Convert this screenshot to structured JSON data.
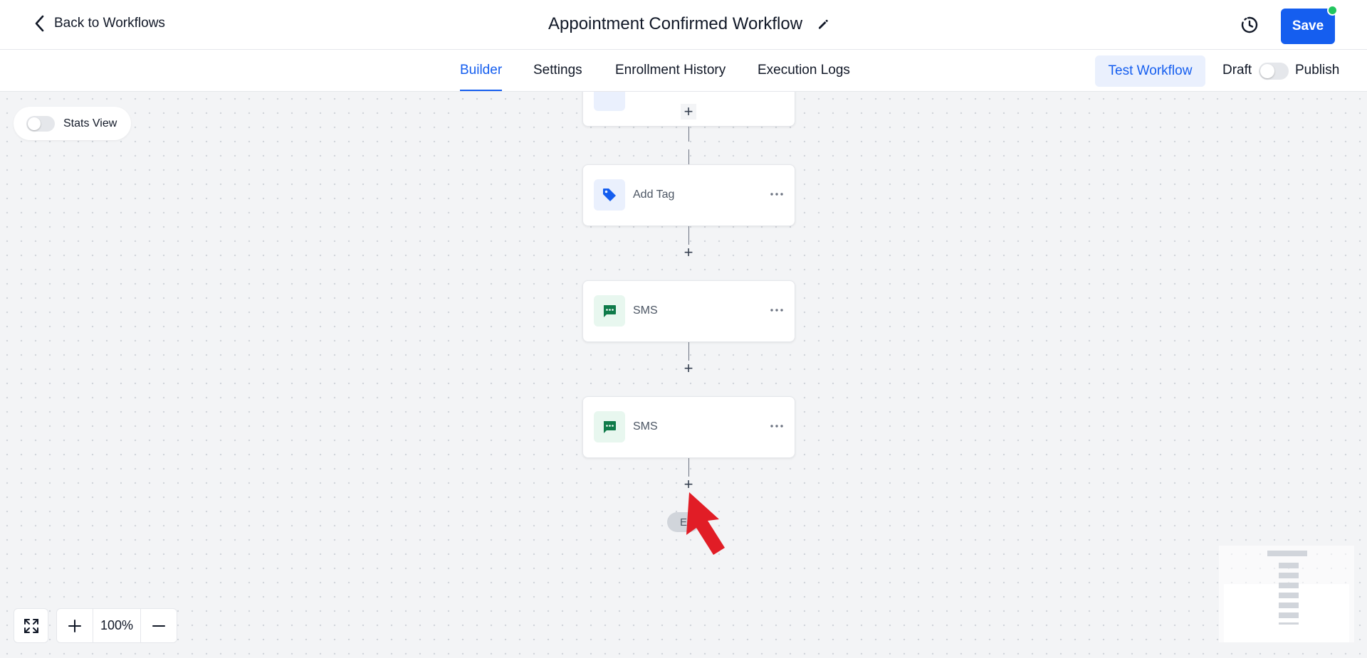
{
  "header": {
    "back_label": "Back to Workflows",
    "title": "Appointment Confirmed Workflow",
    "save_label": "Save"
  },
  "tabs": [
    {
      "label": "Builder",
      "active": true
    },
    {
      "label": "Settings",
      "active": false
    },
    {
      "label": "Enrollment History",
      "active": false
    },
    {
      "label": "Execution Logs",
      "active": false
    }
  ],
  "toolbar": {
    "test_label": "Test Workflow",
    "draft_label": "Draft",
    "publish_label": "Publish",
    "published": false
  },
  "canvas": {
    "stats_label": "Stats View",
    "stats_on": false,
    "nodes": [
      {
        "label": "Add Tag",
        "icon": "tag-icon"
      },
      {
        "label": "SMS",
        "icon": "message-icon"
      },
      {
        "label": "SMS",
        "icon": "message-icon"
      }
    ],
    "end_label": "E"
  },
  "zoom": {
    "value": "100%"
  },
  "colors": {
    "accent": "#155eef",
    "sms": "#0f7b4a",
    "status_dot": "#22c55e",
    "annotation_arrow": "#e11d26"
  }
}
